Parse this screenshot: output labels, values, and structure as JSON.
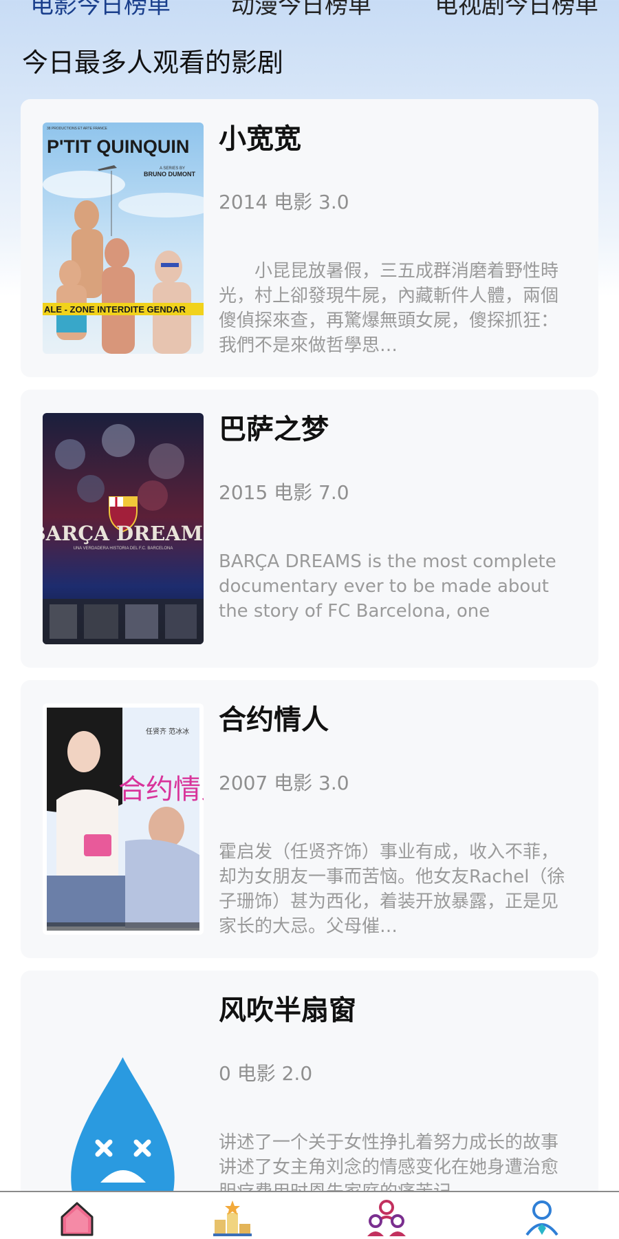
{
  "tabs": [
    {
      "label": "电影今日榜单",
      "active": true
    },
    {
      "label": "动漫今日榜单",
      "active": false
    },
    {
      "label": "电视剧今日榜单",
      "active": false
    }
  ],
  "section_title": "今日最多人观看的影剧",
  "items": [
    {
      "title": "小宽宽",
      "meta": "2014 电影 3.0",
      "desc": "　　小昆昆放暑假，三五成群消磨着野性時光，村上卻發現牛屍，內藏斬件人體，兩個傻偵探來查，再驚爆無頭女屍，傻探抓狂：我們不是來做哲學思…",
      "poster": {
        "title": "P'TIT QUINQUIN",
        "band": "ALE - ZONE INTERDITE    GENDAR",
        "credit": "BRUNO DUMONT",
        "top": "38 PRODUCTIONS ET ARTE FRANCE",
        "series": "A SERIES BY"
      }
    },
    {
      "title": "巴萨之梦",
      "meta": "2015 电影 7.0",
      "desc": "BARÇA DREAMS is the most complete documentary ever to be made about the story of FC Barcelona, one",
      "poster": {
        "title": "BARÇA DREAMS",
        "sub": "UNA VERDADERA HISTORIA DEL F.C. BARCELONA"
      }
    },
    {
      "title": "合约情人",
      "meta": "2007 电影 3.0",
      "desc": "霍启发（任贤齐饰）事业有成，收入不菲，却为女朋友一事而苦恼。他女友Rachel（徐子珊饰）甚为西化，着装开放暴露，正是见家长的大忌。父母催…",
      "poster": {
        "title": "合约情人",
        "cast": "任贤齐 范冰冰"
      }
    },
    {
      "title": "风吹半扇窗",
      "meta": "0 电影 2.0",
      "desc": "讲述了一个关于女性挣扎着努力成长的故事讲述了女主角刘念的情感变化在她身遭治愈胆疗费用时恩先家庭的痛苦记",
      "poster": {
        "placeholder": "sad-drop"
      }
    }
  ],
  "nav": [
    {
      "icon": "home-icon",
      "active": true
    },
    {
      "icon": "ranking-icon",
      "active": false
    },
    {
      "icon": "community-icon",
      "active": false
    },
    {
      "icon": "profile-icon",
      "active": false
    }
  ],
  "colors": {
    "accent": "#1a3f8c",
    "drop": "#2a9ae0",
    "card": "#f7f8fa",
    "home_pink": "#f06b8f"
  }
}
